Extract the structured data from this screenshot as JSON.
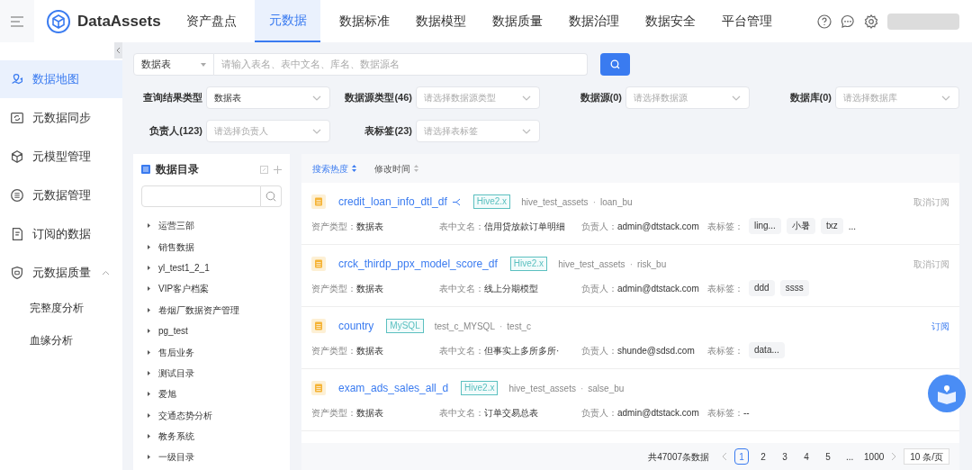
{
  "app": {
    "name": "DataAssets"
  },
  "nav": [
    {
      "label": "资产盘点",
      "selected": false
    },
    {
      "label": "元数据",
      "selected": true
    },
    {
      "label": "数据标准",
      "selected": false
    },
    {
      "label": "数据模型",
      "selected": false
    },
    {
      "label": "数据质量",
      "selected": false
    },
    {
      "label": "数据治理",
      "selected": false
    },
    {
      "label": "数据安全",
      "selected": false
    },
    {
      "label": "平台管理",
      "selected": false
    }
  ],
  "sidebar": {
    "items": [
      {
        "label": "数据地图",
        "selected": true
      },
      {
        "label": "元数据同步",
        "selected": false
      },
      {
        "label": "元模型管理",
        "selected": false
      },
      {
        "label": "元数据管理",
        "selected": false
      },
      {
        "label": "订阅的数据",
        "selected": false
      },
      {
        "label": "元数据质量",
        "selected": false,
        "expanded": true,
        "children": [
          {
            "label": "完整度分析",
            "selected": false
          },
          {
            "label": "血缘分析",
            "selected": false
          }
        ]
      }
    ]
  },
  "search": {
    "scope": "数据表",
    "placeholder": "请输入表名、表中文名、库名、数据源名"
  },
  "filters": [
    {
      "label": "查询结果类型",
      "value": "数据表"
    },
    {
      "label": "数据源类型(46)",
      "placeholder": "请选择数据源类型"
    },
    {
      "label": "数据源(0)",
      "placeholder": "请选择数据源"
    },
    {
      "label": "数据库(0)",
      "placeholder": "请选择数据库"
    },
    {
      "label": "负责人(123)",
      "placeholder": "请选择负责人"
    },
    {
      "label": "表标签(23)",
      "placeholder": "请选择表标签"
    }
  ],
  "catalog": {
    "title": "数据目录",
    "items": [
      "运营三部",
      "销售数据",
      "yl_test1_2_1",
      "VIP客户档案",
      "卷烟厂数据资产管理",
      "pg_test",
      "售后业务",
      "测试目录",
      "爱旭",
      "交通态势分析",
      "教务系统",
      "一级目录"
    ]
  },
  "sort": [
    {
      "label": "搜索热度",
      "selected": true
    },
    {
      "label": "修改时间",
      "selected": false
    }
  ],
  "results": [
    {
      "name": "credit_loan_info_dtl_df",
      "lineage": true,
      "engine": "Hive2.x",
      "database": "hive_test_assets",
      "separator": "·",
      "schema": "loan_bu",
      "fields": [
        {
          "label": "资产类型：",
          "value": "数据表"
        },
        {
          "label": "表中文名：",
          "value": "信用贷放款订单明细"
        },
        {
          "label": "负责人：",
          "value": "admin@dtstack.com"
        }
      ],
      "tags_label": "表标签：",
      "tags": [
        "ling...",
        "小暑",
        "txz"
      ],
      "more_tags": "...",
      "subscribed": true,
      "action": "取消订阅"
    },
    {
      "name": "crck_thirdp_ppx_model_score_df",
      "lineage": false,
      "engine": "Hive2.x",
      "database": "hive_test_assets",
      "separator": "·",
      "schema": "risk_bu",
      "fields": [
        {
          "label": "资产类型：",
          "value": "数据表"
        },
        {
          "label": "表中文名：",
          "value": "线上分期模型"
        },
        {
          "label": "负责人：",
          "value": "admin@dtstack.com"
        }
      ],
      "tags_label": "表标签：",
      "tags": [
        "ddd",
        "ssss"
      ],
      "subscribed": true,
      "action": "取消订阅"
    },
    {
      "name": "country",
      "lineage": false,
      "engine": "MySQL",
      "database": "test_c_MYSQL",
      "separator": "·",
      "schema": "test_c",
      "fields": [
        {
          "label": "资产类型：",
          "value": "数据表"
        },
        {
          "label": "表中文名：",
          "value": "但事实上多所多所·"
        },
        {
          "label": "负责人：",
          "value": "shunde@sdsd.com"
        }
      ],
      "tags_label": "表标签：",
      "tags": [
        "data..."
      ],
      "subscribed": false,
      "action": "订阅"
    },
    {
      "name": "exam_ads_sales_all_d",
      "lineage": false,
      "engine": "Hive2.x",
      "database": "hive_test_assets",
      "separator": "·",
      "schema": "salse_bu",
      "fields": [
        {
          "label": "资产类型：",
          "value": "数据表"
        },
        {
          "label": "表中文名：",
          "value": "订单交易总表"
        },
        {
          "label": "负责人：",
          "value": "admin@dtstack.com"
        }
      ],
      "tags_label": "表标签：",
      "tags_empty": "--"
    }
  ],
  "pagination": {
    "total": "共47007条数据",
    "pages": [
      {
        "label": "1",
        "selected": true
      },
      {
        "label": "2",
        "selected": false
      },
      {
        "label": "3",
        "selected": false
      },
      {
        "label": "4",
        "selected": false
      },
      {
        "label": "5",
        "selected": false
      },
      {
        "label": "...",
        "selected": false
      },
      {
        "label": "1000",
        "selected": false
      }
    ],
    "page_size": "10 条/页"
  }
}
